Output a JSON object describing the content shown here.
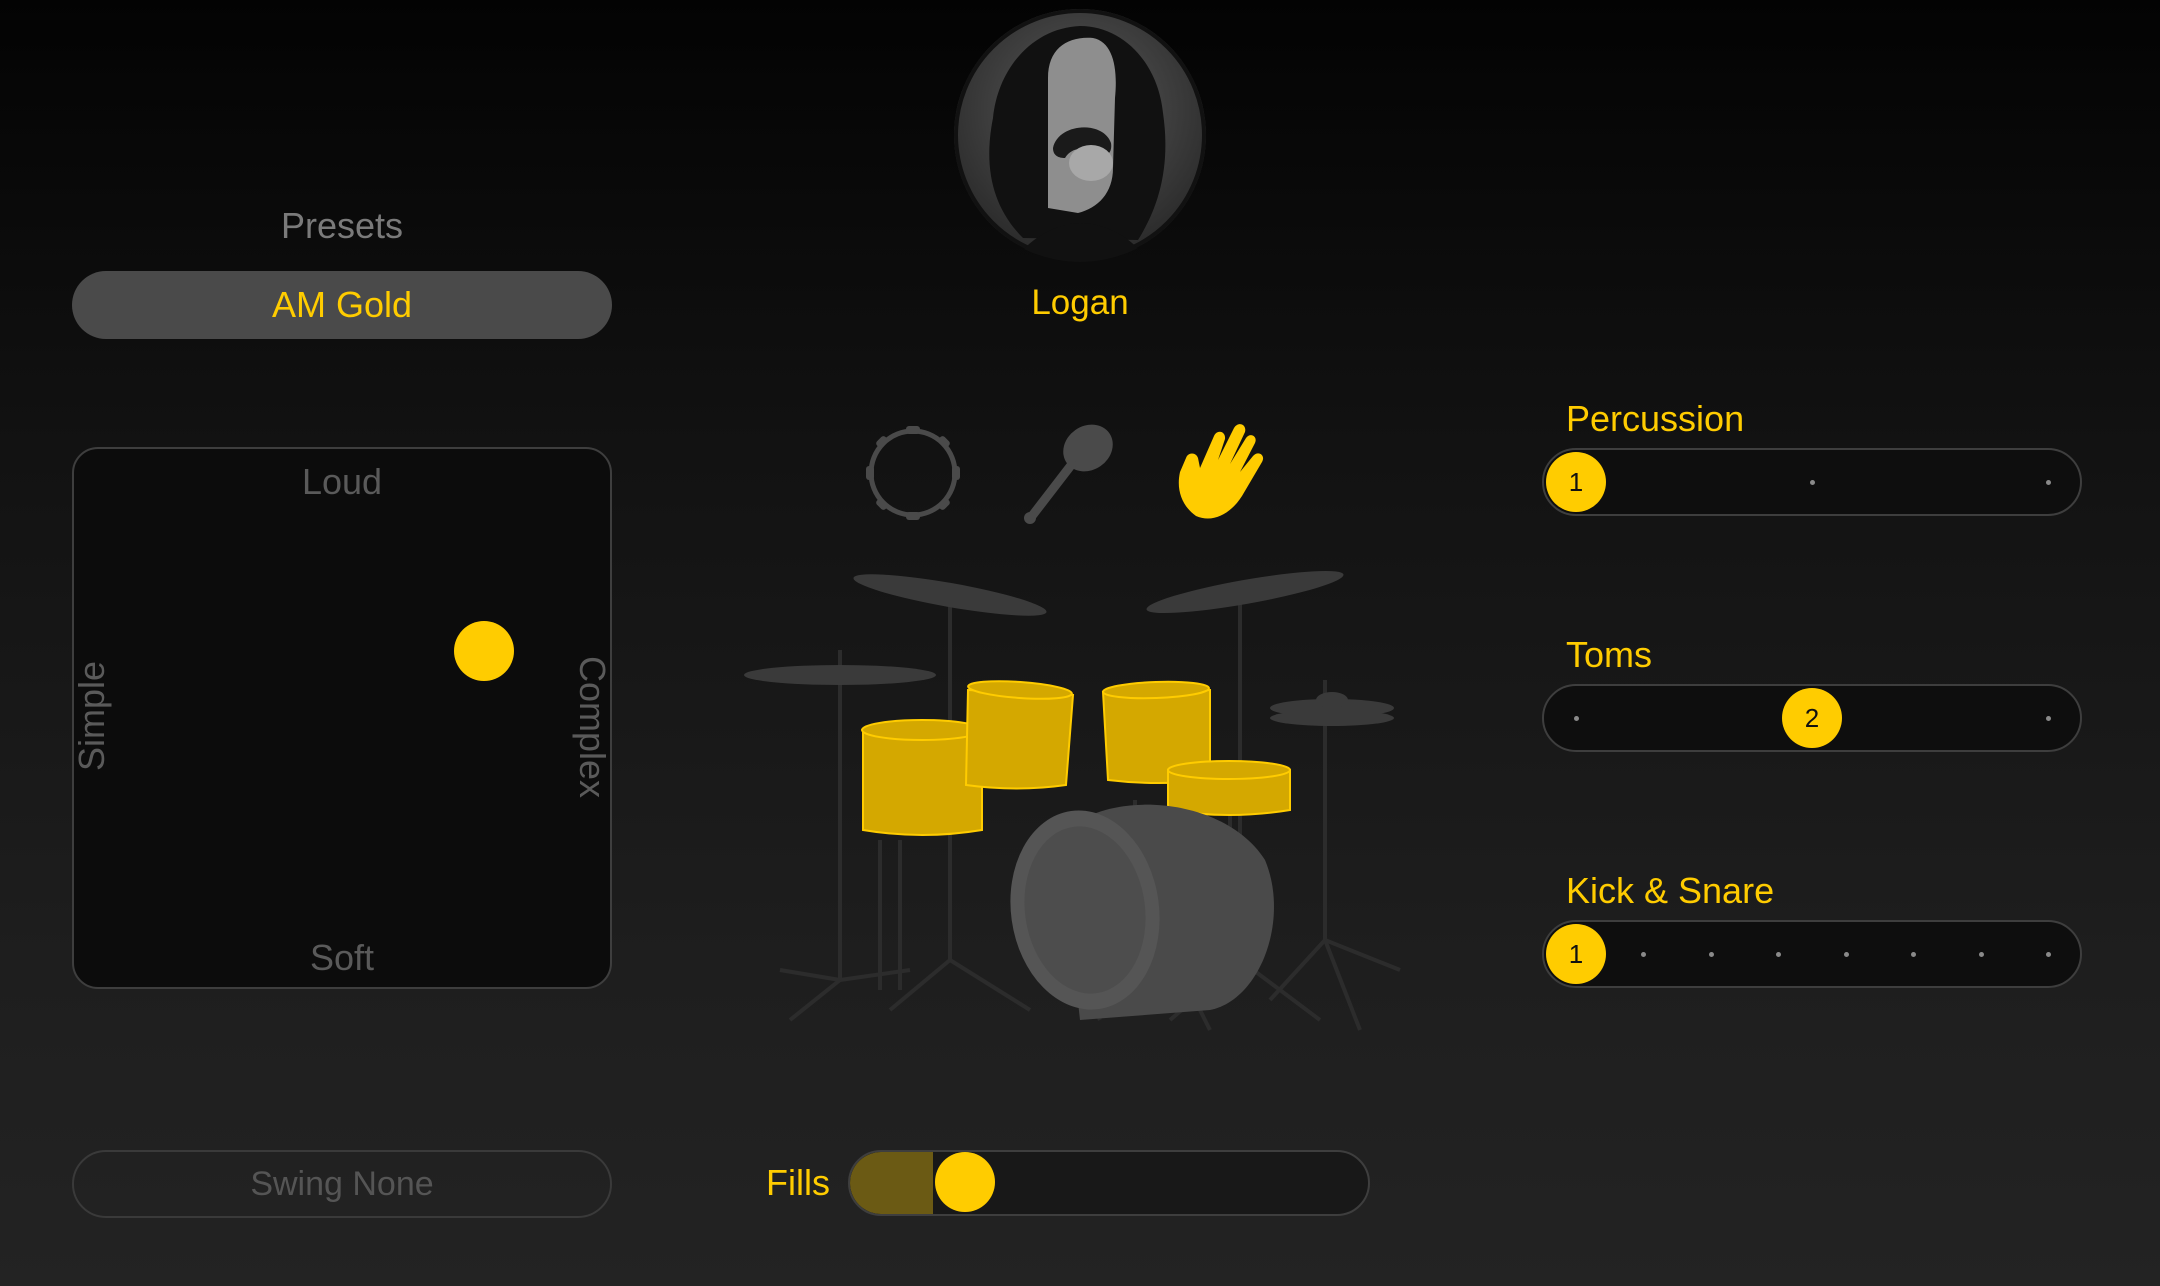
{
  "presets": {
    "title": "Presets",
    "selected": "AM Gold"
  },
  "xy_pad": {
    "top_label": "Loud",
    "bottom_label": "Soft",
    "left_label": "Simple",
    "right_label": "Complex"
  },
  "swing": {
    "label": "Swing None"
  },
  "drummer": {
    "name": "Logan"
  },
  "instruments": [
    {
      "icon": "tambourine-icon",
      "active": false
    },
    {
      "icon": "shaker-icon",
      "active": false
    },
    {
      "icon": "clap-hand-icon",
      "active": true
    }
  ],
  "fills": {
    "label": "Fills",
    "level": 0.16
  },
  "sliders": [
    {
      "name": "Percussion",
      "steps": 3,
      "value": 1,
      "knob_text": "1"
    },
    {
      "name": "Toms",
      "steps": 3,
      "value": 2,
      "knob_text": "2"
    },
    {
      "name": "Kick & Snare",
      "steps": 8,
      "value": 1,
      "knob_text": "1"
    }
  ],
  "colors": {
    "accent": "#ffcc00",
    "drum_shell": "#d4a800",
    "hardware": "#3a3a3a"
  }
}
